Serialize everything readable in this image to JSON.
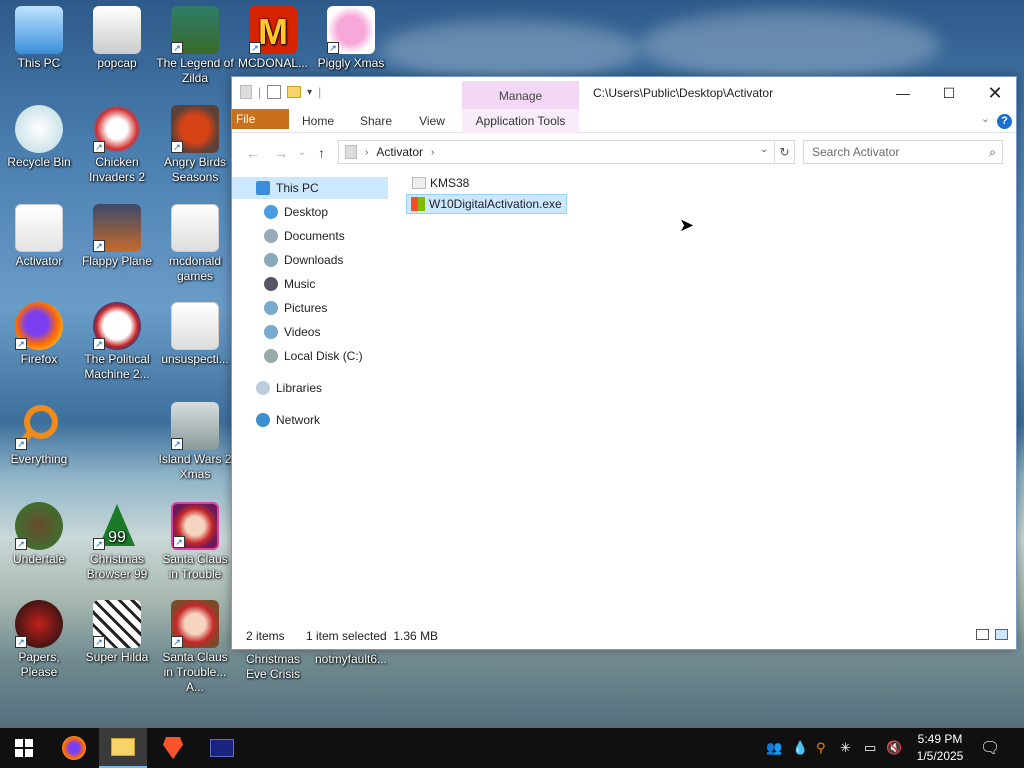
{
  "desktop": {
    "icons": [
      {
        "label": "This PC"
      },
      {
        "label": "popcap"
      },
      {
        "label": "The Legend of Zilda"
      },
      {
        "label": "MCDONAL..."
      },
      {
        "label": "Piggly Xmas"
      },
      {
        "label": "Recycle Bin"
      },
      {
        "label": "Chicken Invaders 2"
      },
      {
        "label": "Angry Birds Seasons"
      },
      {
        "label": "Activator"
      },
      {
        "label": "Flappy Plane"
      },
      {
        "label": "mcdonald games"
      },
      {
        "label": "Firefox"
      },
      {
        "label": "The Political Machine 2..."
      },
      {
        "label": "unsuspecti..."
      },
      {
        "label": "Everything"
      },
      {
        "label": "Island Wars 2 Xmas"
      },
      {
        "label": "Undertale"
      },
      {
        "label": "Christmas Browser 99"
      },
      {
        "label": "Santa Claus in Trouble"
      },
      {
        "label": "Papers, Please"
      },
      {
        "label": "Super Hilda"
      },
      {
        "label": "Santa Claus in Trouble... A..."
      },
      {
        "label": "Christmas Eve Crisis"
      },
      {
        "label": "notmyfault6..."
      }
    ]
  },
  "explorer": {
    "title": "C:\\Users\\Public\\Desktop\\Activator",
    "manage_label": "Manage",
    "tabs": {
      "file": "File",
      "home": "Home",
      "share": "Share",
      "view": "View",
      "app_tools": "Application Tools"
    },
    "address": {
      "crumb": "Activator"
    },
    "search_placeholder": "Search Activator",
    "nav": {
      "this_pc": "This PC",
      "desktop": "Desktop",
      "documents": "Documents",
      "downloads": "Downloads",
      "music": "Music",
      "pictures": "Pictures",
      "videos": "Videos",
      "local_disk": "Local Disk (C:)",
      "libraries": "Libraries",
      "network": "Network"
    },
    "files": [
      {
        "name": "KMS38",
        "type": "folder"
      },
      {
        "name": "W10DigitalActivation.exe",
        "type": "exe",
        "selected": true
      }
    ],
    "status": {
      "count": "2 items",
      "selection": "1 item selected  1.36 MB"
    }
  },
  "taskbar": {
    "time": "5:49 PM",
    "date": "1/5/2025"
  },
  "colors": {
    "file_tab": "#c8701e",
    "manage_tab": "#f2d8f4",
    "selection": "#cce8ff",
    "taskbar": "#101010"
  }
}
